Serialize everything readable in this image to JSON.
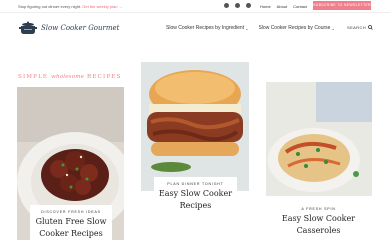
{
  "topbar": {
    "message": "Stop figuring out dinner every night.",
    "message_link": "Get the weekly plan →",
    "social_icons": [
      "facebook-icon",
      "instagram-icon",
      "pinterest-icon"
    ],
    "nav": [
      "Home",
      "About",
      "Contact"
    ],
    "cta": "SUBSCRIBE TO NEWSLETTER"
  },
  "header": {
    "logo_text": "Slow Cooker Gourmet",
    "nav": [
      {
        "label": "Slow Cooker Recipes by Ingredient"
      },
      {
        "label": "Slow Cooker Recipes by Course"
      }
    ],
    "search_label": "SEARCH"
  },
  "section": {
    "title_prefix": "SIMPLE",
    "title_script": "wholesome",
    "title_suffix": "RECIPES"
  },
  "cards": [
    {
      "kicker": "DISCOVER FRESH IDEAS",
      "title": "Gluten Free Slow Cooker Recipes"
    },
    {
      "kicker": "PLAN DINNER TONIGHT",
      "title": "Easy Slow Cooker Recipes"
    },
    {
      "kicker": "A FRESH SPIN",
      "title": "Easy Slow Cooker Casseroles"
    }
  ],
  "colors": {
    "accent": "#f07f8c",
    "text": "#333333"
  }
}
